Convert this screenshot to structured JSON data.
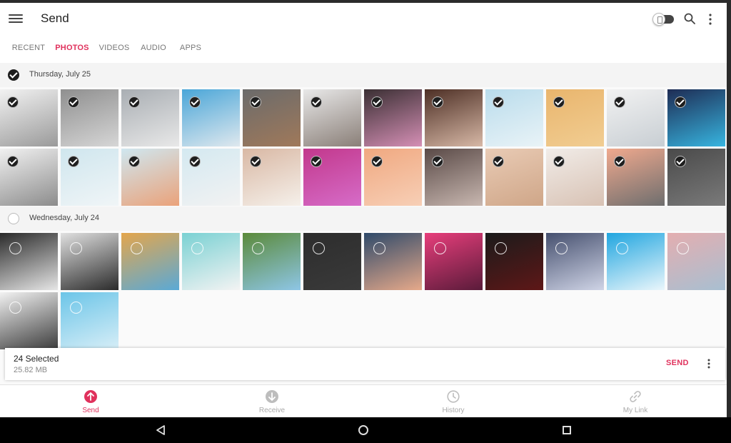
{
  "app": {
    "title": "Send"
  },
  "tabs": [
    {
      "label": "RECENT",
      "active": false
    },
    {
      "label": "PHOTOS",
      "active": true
    },
    {
      "label": "VIDEOS",
      "active": false
    },
    {
      "label": "AUDIO",
      "active": false
    },
    {
      "label": "APPS",
      "active": false
    }
  ],
  "groups": [
    {
      "date": "Thursday, July 25",
      "selected": true
    },
    {
      "date": "Wednesday, July 24",
      "selected": false
    }
  ],
  "photos_group1": [
    {
      "icon": "architecture-photo",
      "colors": [
        "#f2f2f2",
        "#9a9a9a"
      ],
      "selected": true
    },
    {
      "icon": "pyramid-photo",
      "colors": [
        "#8f8f8f",
        "#d6d6d6"
      ],
      "selected": true
    },
    {
      "icon": "triangle-building-photo",
      "colors": [
        "#a9aeb3",
        "#e8e8e8"
      ],
      "selected": true
    },
    {
      "icon": "curved-facade-photo",
      "colors": [
        "#4aa6d8",
        "#dfe8ee"
      ],
      "selected": true
    },
    {
      "icon": "sunset-landscape-photo",
      "colors": [
        "#6b6b6b",
        "#a0795a"
      ],
      "selected": true
    },
    {
      "icon": "monkey-rock-photo",
      "colors": [
        "#e8e8e8",
        "#8a7f78"
      ],
      "selected": true
    },
    {
      "icon": "pink-lamp-photo",
      "colors": [
        "#3a2f33",
        "#d58fb5"
      ],
      "selected": true
    },
    {
      "icon": "portrait-glasses-photo",
      "colors": [
        "#4d2f25",
        "#d7b8a6"
      ],
      "selected": true
    },
    {
      "icon": "person-sky-photo",
      "colors": [
        "#b9dcec",
        "#e9f3f7"
      ],
      "selected": true
    },
    {
      "icon": "orange-wall-photo",
      "colors": [
        "#e9b56d",
        "#f1cd92"
      ],
      "selected": true
    },
    {
      "icon": "cafe-interior-photo",
      "colors": [
        "#f2f2f2",
        "#c8ced3"
      ],
      "selected": true
    },
    {
      "icon": "neon-person-photo",
      "colors": [
        "#1e2c54",
        "#37b5e0"
      ],
      "selected": true
    },
    {
      "icon": "white-arcs-photo",
      "colors": [
        "#f1f1f1",
        "#8c8c8c"
      ],
      "selected": true
    },
    {
      "icon": "window-building-photo",
      "colors": [
        "#cfe6ee",
        "#f0f5f7"
      ],
      "selected": true
    },
    {
      "icon": "roof-apex-photo",
      "colors": [
        "#cfe7f0",
        "#eaa27a"
      ],
      "selected": true
    },
    {
      "icon": "white-roof-photo",
      "colors": [
        "#d4e9f1",
        "#f2f2f2"
      ],
      "selected": true
    },
    {
      "icon": "woman-book-photo",
      "colors": [
        "#d9b8a4",
        "#f5f0ea"
      ],
      "selected": true
    },
    {
      "icon": "pink-car-photo",
      "colors": [
        "#c2388c",
        "#d66cc8"
      ],
      "selected": true
    },
    {
      "icon": "jellyfish-photo",
      "colors": [
        "#f0a880",
        "#f7cfb6"
      ],
      "selected": true
    },
    {
      "icon": "smoke-portrait-photo",
      "colors": [
        "#5a4a47",
        "#c8b7b0"
      ],
      "selected": true
    },
    {
      "icon": "desert-dune-photo",
      "colors": [
        "#e9cbb5",
        "#cfa688"
      ],
      "selected": true
    },
    {
      "icon": "hands-plant-photo",
      "colors": [
        "#f1ece8",
        "#d8c2b4"
      ],
      "selected": true
    },
    {
      "icon": "silhouette-glow-photo",
      "colors": [
        "#f0a98e",
        "#6e6e6e"
      ],
      "selected": true
    },
    {
      "icon": "light-writing-photo",
      "colors": [
        "#4a4a4a",
        "#7a7a7a"
      ],
      "selected": true
    }
  ],
  "photos_group2": [
    {
      "icon": "spiral-staircase-photo",
      "colors": [
        "#2a2a2a",
        "#e6e6e6"
      ],
      "selected": false
    },
    {
      "icon": "white-balconies-photo",
      "colors": [
        "#e0e0e0",
        "#2b2b2b"
      ],
      "selected": false
    },
    {
      "icon": "yellow-building-photo",
      "colors": [
        "#e4a64c",
        "#5aa9d6"
      ],
      "selected": false
    },
    {
      "icon": "white-columns-photo",
      "colors": [
        "#7ad1d3",
        "#f3f3f3"
      ],
      "selected": false
    },
    {
      "icon": "cactus-photo",
      "colors": [
        "#5b8a3a",
        "#8ec6e6"
      ],
      "selected": false
    },
    {
      "icon": "moon-dark-photo",
      "colors": [
        "#2d2d2d",
        "#3a3a3a"
      ],
      "selected": false
    },
    {
      "icon": "clouds-sunset-photo",
      "colors": [
        "#2f4a6a",
        "#e6a98a"
      ],
      "selected": false
    },
    {
      "icon": "neon-pink-photo",
      "colors": [
        "#e73e7b",
        "#5a1b3a"
      ],
      "selected": false
    },
    {
      "icon": "red-light-photo",
      "colors": [
        "#1b1b1b",
        "#5e1717"
      ],
      "selected": false
    },
    {
      "icon": "glass-panel-photo",
      "colors": [
        "#46506f",
        "#cfd4e6"
      ],
      "selected": false
    },
    {
      "icon": "blue-door-photo",
      "colors": [
        "#21a6e0",
        "#eaf6fb"
      ],
      "selected": false
    },
    {
      "icon": "city-skyline-photo",
      "colors": [
        "#e4aeb0",
        "#a8bfd1"
      ],
      "selected": false
    },
    {
      "icon": "curved-wall-photo",
      "colors": [
        "#f2f2f2",
        "#3c3c3c"
      ],
      "selected": false
    },
    {
      "icon": "lighthouse-photo",
      "colors": [
        "#6cc5e8",
        "#d7eef7"
      ],
      "selected": false
    }
  ],
  "selection": {
    "count_label": "24 Selected",
    "size_label": "25.82 MB",
    "send_label": "SEND"
  },
  "bottom_nav": [
    {
      "label": "Send",
      "icon": "send-icon",
      "active": true
    },
    {
      "label": "Receive",
      "icon": "receive-icon",
      "active": false
    },
    {
      "label": "History",
      "icon": "history-icon",
      "active": false
    },
    {
      "label": "My Link",
      "icon": "link-icon",
      "active": false
    }
  ],
  "colors": {
    "accent": "#e0315c",
    "selected_check": "#1e1e1e"
  }
}
